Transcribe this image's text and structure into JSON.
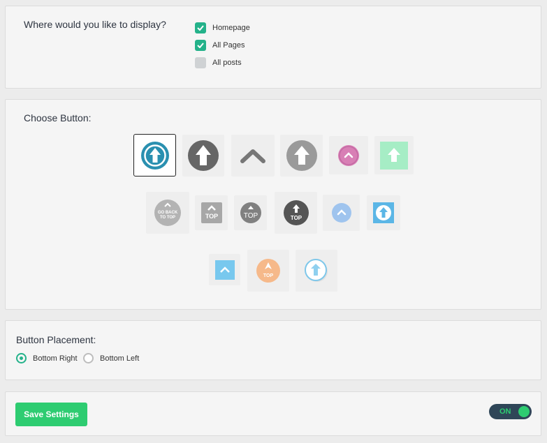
{
  "display": {
    "question": "Where would you like to display?",
    "options": [
      {
        "label": "Homepage",
        "checked": true
      },
      {
        "label": "All Pages",
        "checked": true
      },
      {
        "label": "All posts",
        "checked": false
      }
    ]
  },
  "choose": {
    "heading": "Choose Button:",
    "selected_index": 0,
    "labels": {
      "go_back_line1": "GO BACK",
      "go_back_line2": "TO TOP",
      "top": "TOP"
    }
  },
  "placement": {
    "heading": "Button Placement:",
    "options": [
      {
        "label": "Bottom Right",
        "selected": true
      },
      {
        "label": "Bottom Left",
        "selected": false
      }
    ]
  },
  "footer": {
    "save_label": "Save Settings",
    "toggle_label": "ON",
    "toggle_on": true
  },
  "colors": {
    "accent": "#24b28a",
    "save_button": "#2ecc71",
    "toggle_bg": "#2f4658"
  }
}
